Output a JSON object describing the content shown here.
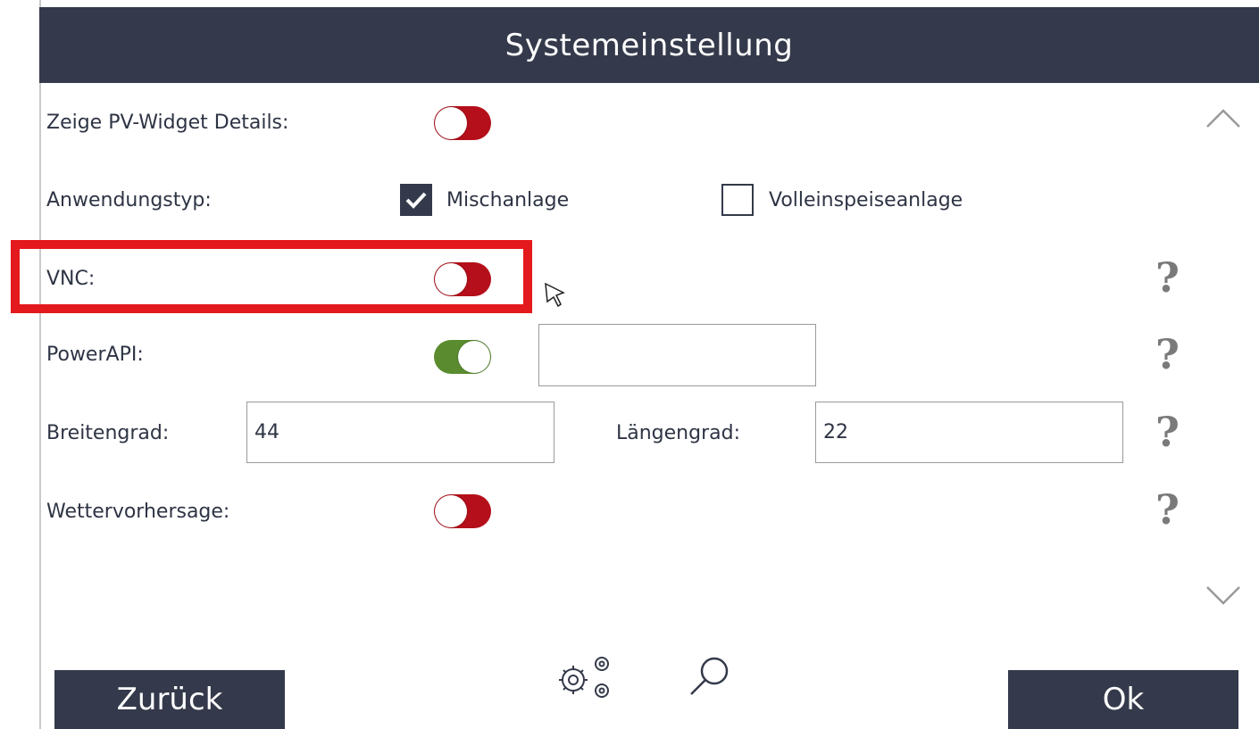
{
  "window": {
    "title": "Systemeinstellung"
  },
  "settings": {
    "pv_widget": {
      "label": "Zeige PV-Widget Details:",
      "enabled": false
    },
    "application_type": {
      "label": "Anwendungstyp:",
      "options": [
        {
          "label": "Mischanlage",
          "checked": true
        },
        {
          "label": "Volleinspeiseanlage",
          "checked": false
        }
      ]
    },
    "vnc": {
      "label": "VNC:",
      "enabled": false
    },
    "powerapi": {
      "label": "PowerAPI:",
      "enabled": true,
      "value": ""
    },
    "latitude": {
      "label": "Breitengrad:",
      "value": "44"
    },
    "longitude": {
      "label": "Längengrad:",
      "value": "22"
    },
    "weather": {
      "label": "Wettervorhersage:",
      "enabled": false
    }
  },
  "help_symbol": "?",
  "buttons": {
    "back": "Zurück",
    "ok": "Ok"
  },
  "colors": {
    "header_bg": "#343a4b",
    "toggle_off": "#b40f1a",
    "toggle_on": "#5a8c2f",
    "highlight": "#e3191d",
    "help": "#7a7a7a"
  },
  "icons": [
    "chevron-up-icon",
    "chevron-down-icon",
    "checkmark-icon",
    "help-icon",
    "gears-icon",
    "magnifier-icon",
    "mouse-cursor-icon"
  ]
}
